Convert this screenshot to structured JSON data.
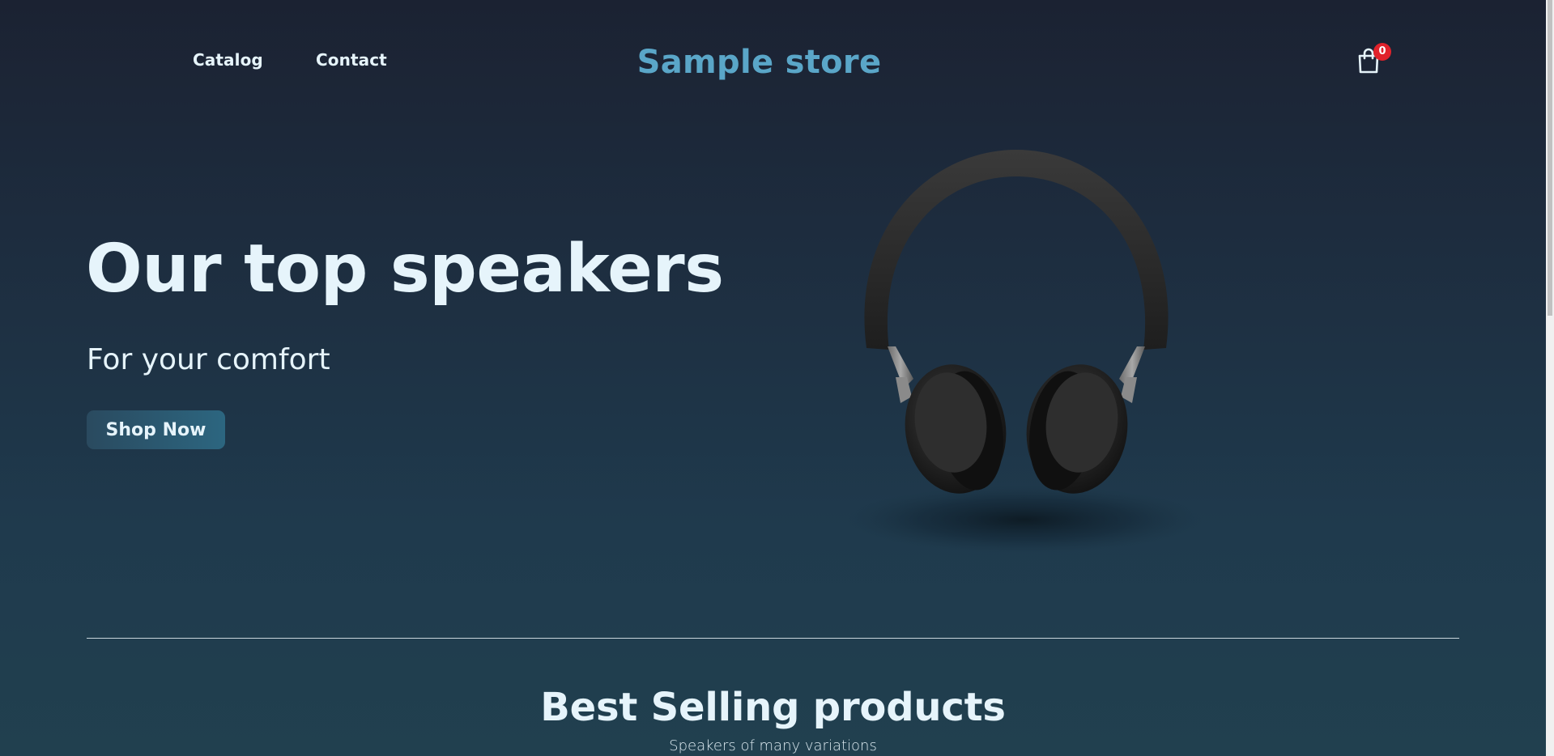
{
  "header": {
    "nav": [
      {
        "label": "Catalog"
      },
      {
        "label": "Contact"
      }
    ],
    "logo": "Sample store",
    "cart": {
      "icon": "shopping-bag-icon",
      "count": "0"
    }
  },
  "hero": {
    "title": "Our top speakers",
    "subtitle": "For your comfort",
    "cta_label": "Shop Now",
    "image": "headphones-image"
  },
  "best_selling": {
    "title": "Best Selling products",
    "subtitle": "Speakers of many variations"
  },
  "colors": {
    "logo": "#5aa6c8",
    "text": "#e6f4fb",
    "badge": "#e0222b",
    "button": "#2c6680"
  }
}
